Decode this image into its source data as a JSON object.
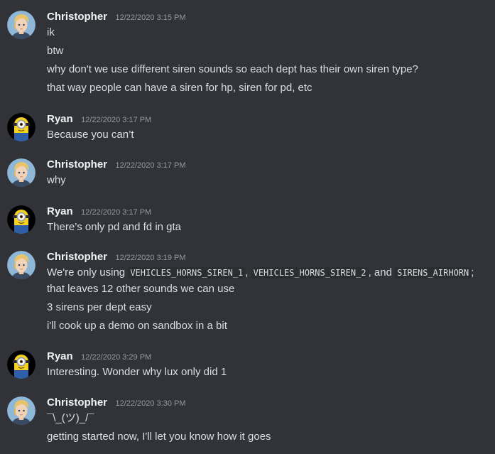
{
  "messages": [
    {
      "author": "Christopher",
      "timestamp": "12/22/2020 3:15 PM",
      "avatar": "christopher-avatar",
      "lines": [
        "ik",
        "btw",
        "why don't we use different siren sounds so each dept has their own siren type?",
        "that way people can have a siren for hp, siren for pd, etc"
      ]
    },
    {
      "author": "Ryan",
      "timestamp": "12/22/2020 3:17 PM",
      "avatar": "minion-avatar",
      "lines": [
        "Because you can’t"
      ]
    },
    {
      "author": "Christopher",
      "timestamp": "12/22/2020 3:17 PM",
      "avatar": "christopher-avatar",
      "lines": [
        "why"
      ]
    },
    {
      "author": "Ryan",
      "timestamp": "12/22/2020 3:17 PM",
      "avatar": "minion-avatar",
      "lines": [
        "There’s only pd and fd in gta"
      ]
    },
    {
      "author": "Christopher",
      "timestamp": "12/22/2020 3:19 PM",
      "avatar": "christopher-avatar",
      "rich_line": {
        "t1": "We're only using ",
        "c1": "VEHICLES_HORNS_SIREN_1",
        "t2": ", ",
        "c2": "VEHICLES_HORNS_SIREN_2",
        "t3": ", and ",
        "c3": "SIRENS_AIRHORN",
        "t4": ";"
      },
      "lines": [
        "that leaves 12 other sounds we can use",
        "3 sirens per dept easy",
        "i'll cook up a demo on sandbox in a bit"
      ]
    },
    {
      "author": "Ryan",
      "timestamp": "12/22/2020 3:29 PM",
      "avatar": "minion-avatar",
      "lines": [
        "Interesting. Wonder why lux only did 1"
      ]
    },
    {
      "author": "Christopher",
      "timestamp": "12/22/2020 3:30 PM",
      "avatar": "christopher-avatar",
      "lines": [
        "¯\\_(ツ)_/¯",
        "getting started now, I'll let you know how it goes"
      ]
    }
  ],
  "colors": {
    "background": "#313338",
    "username": "#f2f3f5",
    "timestamp": "#949ba4",
    "text": "#dbdee1",
    "code_bg": "#2b2d31"
  }
}
